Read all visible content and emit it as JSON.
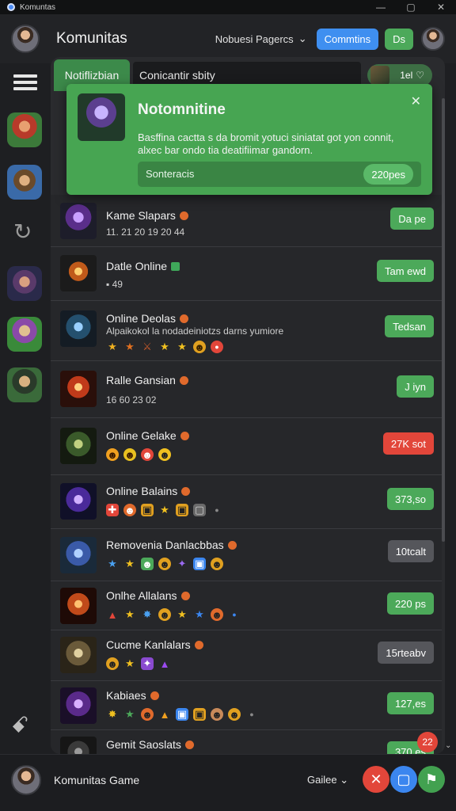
{
  "window": {
    "title": "Komuntas",
    "controls": [
      "—",
      "▢",
      "✕"
    ]
  },
  "header": {
    "title": "Komunitas",
    "pager_label": "Nobuesi Pagercs",
    "button_blue": "Commtins",
    "button_green": "Ds"
  },
  "tabs": {
    "active": "Notiflizbian",
    "field_text": "Conicantir sbity",
    "right_value": "1el"
  },
  "notification": {
    "title": "Notomnitine",
    "body": "Basffina cactta s da bromit yotuci siniatat got yon connit, alxec bar ondo tia deatifiimar gandorn.",
    "bar_label": "Sonteracis",
    "bar_value": "220pes",
    "colors": {
      "background": "#47a552"
    }
  },
  "rows": [
    {
      "name": "Kame Slapars",
      "sub": "11.  21   20  19  20  44",
      "action": "Da pe",
      "action_color": "#4ca95a"
    },
    {
      "name": "Datle Online",
      "sub": "49",
      "action": "Tam ewd",
      "action_color": "#4ca95a"
    },
    {
      "name": "Online Deolas",
      "sub": "Alpaikokol  la nodadeiniotzs  darns yumiore",
      "action": "Tedsan",
      "action_color": "#4ca95a"
    },
    {
      "name": "Ralle Gansian",
      "sub": "16   60        23   02",
      "action": "J iyn",
      "action_color": "#4ca95a"
    },
    {
      "name": "Online Gelake",
      "sub": "",
      "action": "27K sot",
      "action_color": "#e2463a"
    },
    {
      "name": "Online Balains",
      "sub": "",
      "action": "373,so",
      "action_color": "#4ca95a"
    },
    {
      "name": "Removenia Danlacbbas",
      "sub": "",
      "action": "10tcalt",
      "action_color": "#55565b"
    },
    {
      "name": "Onlhe Allalans",
      "sub": "",
      "action": "220 ps",
      "action_color": "#4ca95a"
    },
    {
      "name": "Cucme Kanlalars",
      "sub": "",
      "action": "15rteabv",
      "action_color": "#55565b"
    },
    {
      "name": "Kabiaes",
      "sub": "",
      "action": "127,es",
      "action_color": "#4ca95a"
    },
    {
      "name": "Gemit Saoslats",
      "sub": "",
      "action": "370,es",
      "action_color": "#4ca95a"
    }
  ],
  "badge_count": "22",
  "bottom": {
    "title": "Komunitas Game",
    "select_label": "Gailee"
  }
}
